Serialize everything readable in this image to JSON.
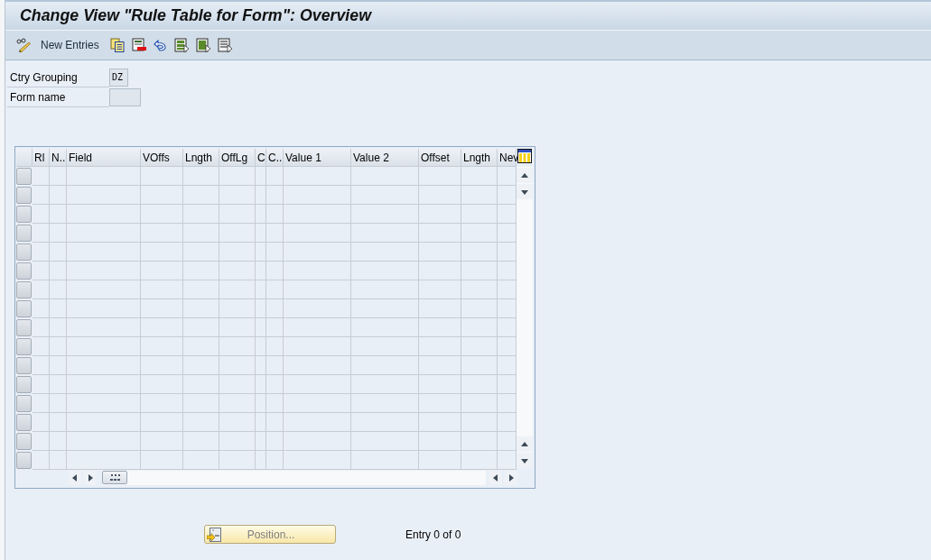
{
  "window": {
    "title": "Change View \"Rule Table for Form\": Overview"
  },
  "toolbar": {
    "new_entries": "New Entries"
  },
  "fields": [
    {
      "label": "Ctry Grouping",
      "value": "DZ"
    },
    {
      "label": "Form name"
    }
  ],
  "table": {
    "columns": [
      "Rl",
      "N..",
      "Field",
      "VOffs",
      "Lngth",
      "OffLg",
      "C",
      "C..",
      "Value 1",
      "Value 2",
      "Offset",
      "Lngth",
      "Nev"
    ]
  },
  "footer": {
    "position_button": "Position...",
    "entry_count": "Entry 0 of 0"
  }
}
